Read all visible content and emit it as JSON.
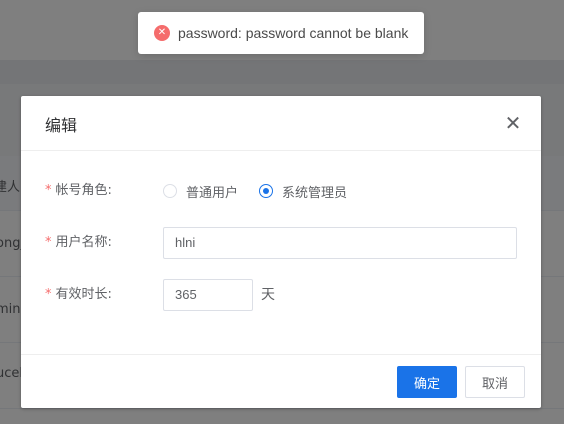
{
  "background": {
    "table_header_fragment": "建人",
    "row_fragments": [
      "ong_",
      "min",
      "ucel"
    ]
  },
  "toast": {
    "icon": "error-circle-icon",
    "message": "password: password cannot be blank",
    "color": "#f56c6c"
  },
  "dialog": {
    "title": "编辑",
    "close_icon": "close-icon",
    "fields": {
      "role": {
        "label": "帐号角色",
        "required_mark": "*",
        "options": [
          "普通用户",
          "系统管理员"
        ],
        "selected": "系统管理员"
      },
      "username": {
        "label": "用户名称",
        "required_mark": "*",
        "value": "hlni"
      },
      "validity": {
        "label": "有效时长",
        "required_mark": "*",
        "value": "365",
        "unit": "天"
      }
    },
    "buttons": {
      "confirm": "确定",
      "cancel": "取消"
    }
  },
  "colors": {
    "primary": "#1a73e8",
    "danger": "#f56c6c"
  }
}
